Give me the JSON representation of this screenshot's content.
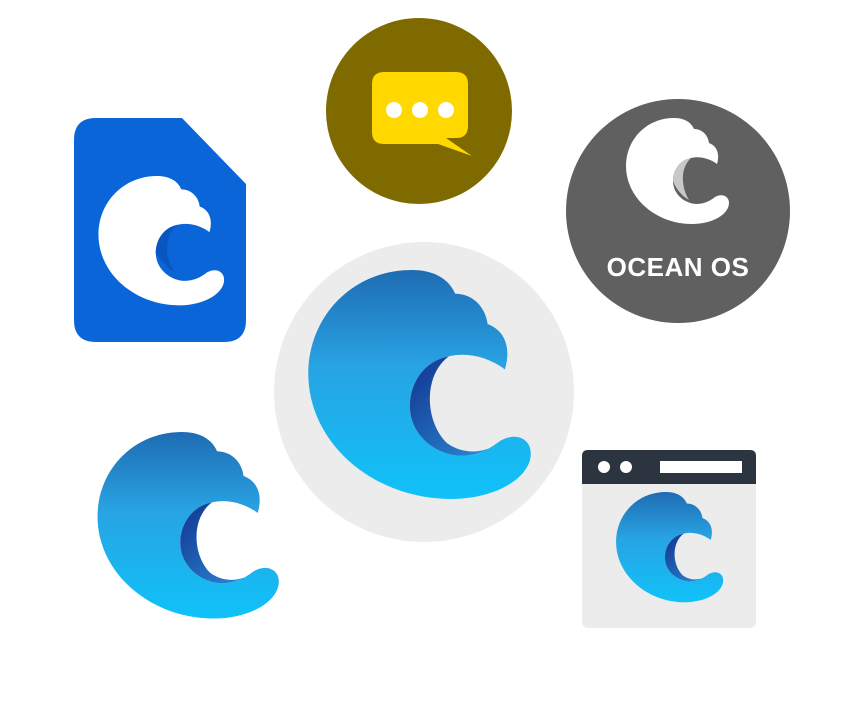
{
  "badge": {
    "label": "OCEAN OS"
  },
  "icons": [
    {
      "name": "chat-bubble-icon",
      "color": "#ffd800",
      "background": "#7f6a00"
    },
    {
      "name": "sim-card-icon",
      "color": "#ffffff",
      "background": "#0a66d8"
    },
    {
      "name": "ocean-os-badge-icon",
      "color": "#ffffff",
      "background": "#606060"
    },
    {
      "name": "wave-logo-icon",
      "colors": [
        "#1f6fb6",
        "#2aa6e6",
        "#12c0f8",
        "#1a3b98"
      ]
    },
    {
      "name": "browser-window-icon",
      "chrome": "#2c3440",
      "background": "#ececec"
    }
  ]
}
